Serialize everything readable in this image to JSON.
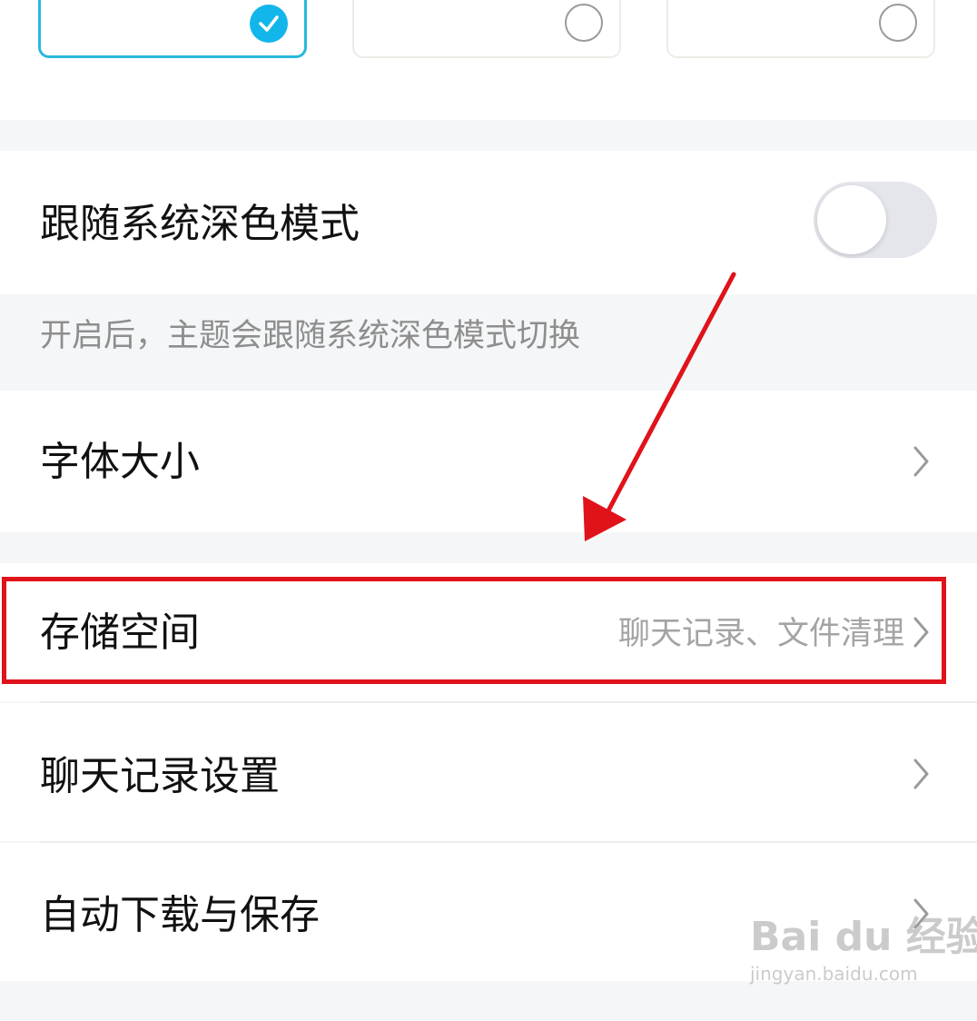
{
  "theme_options": [
    {
      "selected": true
    },
    {
      "selected": false
    },
    {
      "selected": false
    }
  ],
  "follow_dark_mode": {
    "label": "跟随系统深色模式",
    "enabled": false,
    "hint": "开启后，主题会跟随系统深色模式切换"
  },
  "settings": {
    "font_size": {
      "label": "字体大小"
    },
    "storage": {
      "label": "存储空间",
      "value": "聊天记录、文件清理"
    },
    "chat_history": {
      "label": "聊天记录设置"
    },
    "auto_download": {
      "label": "自动下载与保存"
    }
  },
  "annotation": {
    "color": "#e0121a"
  },
  "watermark": {
    "logo": "Bai du 经验",
    "url": "jingyan.baidu.com"
  },
  "colors": {
    "accent": "#13b6ea",
    "selected_border": "#27b8de"
  }
}
